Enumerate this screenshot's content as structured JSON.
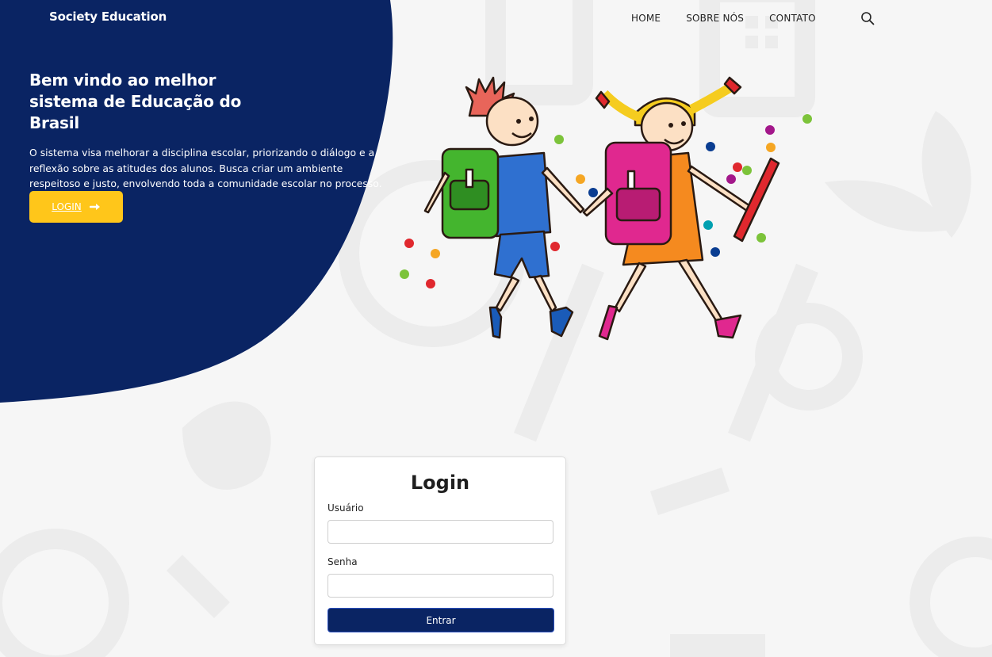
{
  "header": {
    "brand": "Society Education",
    "nav": [
      {
        "label": "HOME"
      },
      {
        "label": "SOBRE NÓS"
      },
      {
        "label": "CONTATO"
      }
    ],
    "search_icon": "search-icon"
  },
  "hero": {
    "title": "Bem vindo ao melhor sistema de Educação do Brasil",
    "description": "O sistema visa melhorar a disciplina escolar, priorizando o diálogo e a reflexão sobre as atitudes dos alunos. Busca criar um ambiente respeitoso e justo, envolvendo toda a comunidade escolar no processo.",
    "login_label": "LOGIN",
    "login_icon": "arrow-right-icon"
  },
  "login_form": {
    "title": "Login",
    "username_label": "Usuário",
    "username_value": "",
    "password_label": "Senha",
    "password_value": "",
    "submit_label": "Entrar"
  },
  "colors": {
    "navy": "#0a2463",
    "yellow": "#ffc61a",
    "background": "#f6f6f6"
  }
}
